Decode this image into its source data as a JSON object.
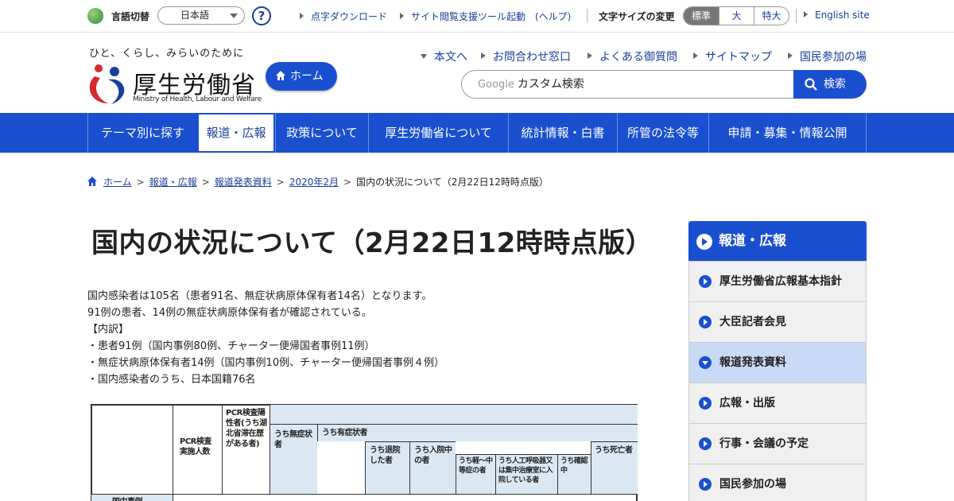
{
  "utility": {
    "language_label": "言語切替",
    "language_selected": "日本語",
    "help_glyph": "?",
    "links": [
      "点字ダウンロード",
      "サイト閲覧支援ツール起動　(ヘルプ)"
    ],
    "font_size_label": "文字サイズの変更",
    "font_sizes": [
      "標準",
      "大",
      "特大"
    ],
    "english_site": "English site"
  },
  "header": {
    "tagline": "ひと、くらし、みらいのために",
    "logo_text": "厚生労働省",
    "logo_en": "Ministry of Health, Labour and Welfare",
    "home_button": "ホーム",
    "links": [
      "本文へ",
      "お問合わせ窓口",
      "よくある御質問",
      "サイトマップ",
      "国民参加の場"
    ],
    "search_google": "Google",
    "search_placeholder": "カスタム検索",
    "search_button": "検索"
  },
  "gnav": [
    "テーマ別に探す",
    "報道・広報",
    "政策について",
    "厚生労働省について",
    "統計情報・白書",
    "所管の法令等",
    "申請・募集・情報公開"
  ],
  "breadcrumb": [
    "ホーム",
    "報道・広報",
    "報道発表資料",
    "2020年2月",
    "国内の状況について（2月22日12時時点版）"
  ],
  "main": {
    "title": "国内の状況について（2月22日12時時点版）",
    "paragraphs": [
      "国内感染者は105名（患者91名、無症状病原体保有者14名）となります。",
      "91例の患者、14例の無症状病原体保有者が確認されている。",
      "【内訳】",
      "・患者91例（国内事例80例、チャーター便帰国者事例11例）",
      "・無症状病原体保有者14例（国内事例10例、チャーター便帰国者事例４例）",
      "・国内感染者のうち、日本国籍76名"
    ],
    "table": {
      "pcr_tests": "PCR検査実施人数",
      "pcr_positive": "PCR検査陽性者(うち湖北省滞在歴がある者)",
      "asymptomatic": "うち無症状者",
      "symptomatic": "うち有症状者",
      "discharged": "うち退院した者",
      "hospitalized": "うち入院中の者",
      "mild": "うち軽〜中等症の者",
      "severe": "うち人工呼吸器又は集中治療室に入院している者",
      "confirming": "うち確認中",
      "deaths": "うち死亡者",
      "row_domestic": "国内事例"
    }
  },
  "sidebar": {
    "heading": "報道・広報",
    "items": [
      "厚生労働省広報基本指針",
      "大臣記者会見",
      "報道発表資料",
      "広報・出版",
      "行事・会議の予定",
      "国民参加の場"
    ]
  },
  "colors": {
    "brand": "#1a4fd0",
    "link": "#1a3e9a",
    "sidebar_active": "#c8daf5",
    "table_shade": "#dbe8f4"
  }
}
